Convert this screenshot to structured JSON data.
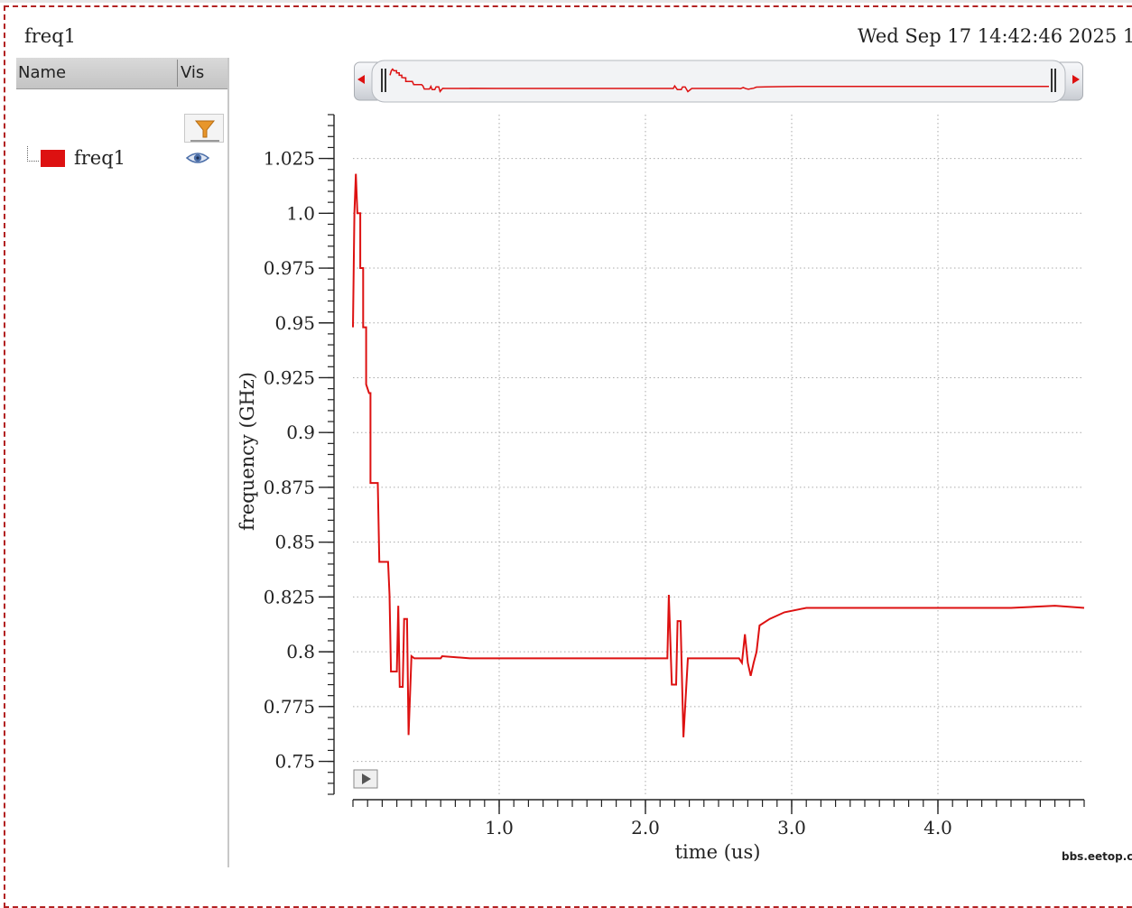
{
  "window": {
    "title": "freq1",
    "date": "Wed Sep 17 14:42:46 2025 1"
  },
  "legend": {
    "col_name": "Name",
    "col_vis": "Vis",
    "items": [
      {
        "name": "freq1",
        "color": "#dd1111"
      }
    ]
  },
  "watermark": "bbs.eetop.cn",
  "chart_data": {
    "type": "line",
    "xlabel": "time (us)",
    "ylabel": "frequency (GHz)",
    "xlim": [
      0,
      5.0
    ],
    "ylim": [
      0.735,
      1.045
    ],
    "x_ticks": [
      1.0,
      2.0,
      3.0,
      4.0
    ],
    "x_tick_labels": [
      "1.0",
      "2.0",
      "3.0",
      "4.0"
    ],
    "y_ticks": [
      1.025,
      1.0,
      0.975,
      0.95,
      0.925,
      0.9,
      0.875,
      0.85,
      0.825,
      0.8,
      0.775,
      0.75
    ],
    "y_tick_labels": [
      "1.025",
      "1.0",
      "0.975",
      "0.95",
      "0.925",
      "0.9",
      "0.875",
      "0.85",
      "0.825",
      "0.8",
      "0.775",
      "0.75"
    ],
    "grid": true,
    "series": [
      {
        "color": "#dd1111",
        "points": [
          [
            0.0,
            0.948
          ],
          [
            0.01,
            1.0
          ],
          [
            0.02,
            1.018
          ],
          [
            0.03,
            1.0
          ],
          [
            0.05,
            1.0
          ],
          [
            0.05,
            0.975
          ],
          [
            0.07,
            0.975
          ],
          [
            0.07,
            0.948
          ],
          [
            0.09,
            0.948
          ],
          [
            0.09,
            0.922
          ],
          [
            0.11,
            0.918
          ],
          [
            0.12,
            0.918
          ],
          [
            0.12,
            0.877
          ],
          [
            0.17,
            0.877
          ],
          [
            0.18,
            0.841
          ],
          [
            0.24,
            0.841
          ],
          [
            0.25,
            0.826
          ],
          [
            0.26,
            0.791
          ],
          [
            0.3,
            0.791
          ],
          [
            0.31,
            0.821
          ],
          [
            0.32,
            0.784
          ],
          [
            0.34,
            0.784
          ],
          [
            0.35,
            0.815
          ],
          [
            0.37,
            0.815
          ],
          [
            0.38,
            0.762
          ],
          [
            0.4,
            0.798
          ],
          [
            0.42,
            0.797
          ],
          [
            0.6,
            0.797
          ],
          [
            0.61,
            0.798
          ],
          [
            0.8,
            0.797
          ],
          [
            1.0,
            0.797
          ],
          [
            1.2,
            0.797
          ],
          [
            1.4,
            0.797
          ],
          [
            1.6,
            0.797
          ],
          [
            1.8,
            0.797
          ],
          [
            2.0,
            0.797
          ],
          [
            2.15,
            0.797
          ],
          [
            2.16,
            0.826
          ],
          [
            2.18,
            0.785
          ],
          [
            2.21,
            0.785
          ],
          [
            2.22,
            0.814
          ],
          [
            2.24,
            0.814
          ],
          [
            2.26,
            0.761
          ],
          [
            2.29,
            0.797
          ],
          [
            2.4,
            0.797
          ],
          [
            2.55,
            0.797
          ],
          [
            2.64,
            0.797
          ],
          [
            2.66,
            0.795
          ],
          [
            2.68,
            0.808
          ],
          [
            2.7,
            0.795
          ],
          [
            2.72,
            0.789
          ],
          [
            2.74,
            0.795
          ],
          [
            2.76,
            0.8
          ],
          [
            2.78,
            0.812
          ],
          [
            2.85,
            0.815
          ],
          [
            2.95,
            0.818
          ],
          [
            3.1,
            0.82
          ],
          [
            3.3,
            0.82
          ],
          [
            3.6,
            0.82
          ],
          [
            3.9,
            0.82
          ],
          [
            4.2,
            0.82
          ],
          [
            4.5,
            0.82
          ],
          [
            4.8,
            0.821
          ],
          [
            5.0,
            0.82
          ]
        ]
      }
    ]
  }
}
